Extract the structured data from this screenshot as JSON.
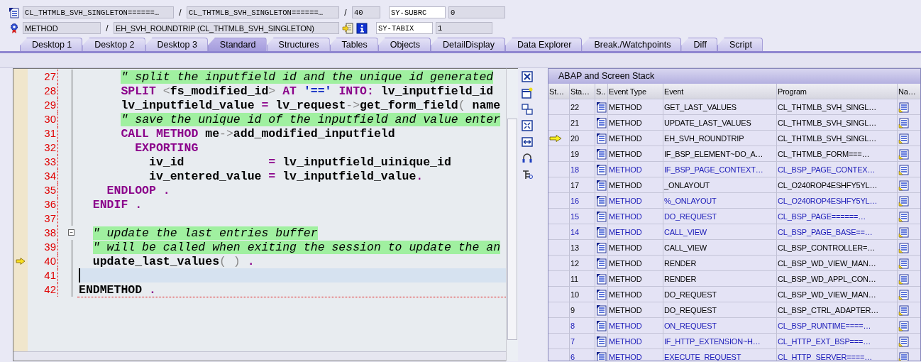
{
  "header_rows": [
    {
      "items": [
        {
          "kind": "field",
          "text": "CL_THTMLB_SVH_SINGLETON======…"
        },
        {
          "kind": "separator",
          "text": "/"
        },
        {
          "kind": "field",
          "text": "CL_THTMLB_SVH_SINGLETON======…"
        },
        {
          "kind": "separator",
          "text": "/"
        },
        {
          "kind": "field",
          "text": "40"
        }
      ],
      "sysvar_name": "SY-SUBRC",
      "sysvar_value": "0"
    },
    {
      "items": [
        {
          "kind": "field",
          "text": "METHOD"
        },
        {
          "kind": "separator",
          "text": "/"
        },
        {
          "kind": "field",
          "text": "EH_SVH_ROUNDTRIP (CL_THTMLB_SVH_SINGLETON)"
        },
        {
          "kind": "navigate"
        },
        {
          "kind": "info"
        }
      ],
      "sysvar_name": "SY-TABIX",
      "sysvar_value": "1"
    }
  ],
  "tabs": [
    {
      "label": "Desktop 1",
      "selected": false
    },
    {
      "label": "Desktop 2",
      "selected": false
    },
    {
      "label": "Desktop 3",
      "selected": false
    },
    {
      "label": "Standard",
      "selected": true
    },
    {
      "label": "Structures",
      "selected": false
    },
    {
      "label": "Tables",
      "selected": false
    },
    {
      "label": "Objects",
      "selected": false
    },
    {
      "label": "DetailDisplay",
      "selected": false
    },
    {
      "label": "Data Explorer",
      "selected": false
    },
    {
      "label": "Break./Watchpoints",
      "selected": false
    },
    {
      "label": "Diff",
      "selected": false
    },
    {
      "label": "Script",
      "selected": false
    }
  ],
  "code_lines": [
    {
      "number": "27",
      "tokens": [
        {
          "kind": "comment",
          "text": "      \" split the inputfield id and the unique id generated"
        }
      ],
      "current": false,
      "cursor": false
    },
    {
      "number": "28",
      "tokens": [
        {
          "kind": "keyword",
          "text": "      SPLIT "
        },
        {
          "kind": "op",
          "text": "<"
        },
        {
          "kind": "ident",
          "text": "fs_modified_id"
        },
        {
          "kind": "op",
          "text": "> "
        },
        {
          "kind": "keyword",
          "text": "AT "
        },
        {
          "kind": "string",
          "text": "'==' "
        },
        {
          "kind": "keyword",
          "text": "INTO: "
        },
        {
          "kind": "ident",
          "text": "lv_inputfield_id"
        }
      ],
      "current": false,
      "cursor": false
    },
    {
      "number": "29",
      "tokens": [
        {
          "kind": "ident",
          "text": "      lv_inputfield_value "
        },
        {
          "kind": "keyword",
          "text": "= "
        },
        {
          "kind": "ident",
          "text": "lv_request"
        },
        {
          "kind": "op",
          "text": "->"
        },
        {
          "kind": "ident",
          "text": "get_form_field"
        },
        {
          "kind": "op",
          "text": "( "
        },
        {
          "kind": "ident",
          "text": "name"
        }
      ],
      "current": false,
      "cursor": false
    },
    {
      "number": "30",
      "tokens": [
        {
          "kind": "comment",
          "text": "      \" save the unique id of the inputfield and value enter"
        }
      ],
      "current": false,
      "cursor": false
    },
    {
      "number": "31",
      "tokens": [
        {
          "kind": "keyword",
          "text": "      CALL METHOD "
        },
        {
          "kind": "ident",
          "text": "me"
        },
        {
          "kind": "op",
          "text": "->"
        },
        {
          "kind": "ident",
          "text": "add_modified_inputfield"
        }
      ],
      "current": false,
      "cursor": false
    },
    {
      "number": "32",
      "tokens": [
        {
          "kind": "keyword",
          "text": "        EXPORTING"
        }
      ],
      "current": false,
      "cursor": false
    },
    {
      "number": "33",
      "tokens": [
        {
          "kind": "ident",
          "text": "          iv_id            "
        },
        {
          "kind": "keyword",
          "text": "= "
        },
        {
          "kind": "ident",
          "text": "lv_inputfield_uinique_id"
        }
      ],
      "current": false,
      "cursor": false
    },
    {
      "number": "34",
      "tokens": [
        {
          "kind": "ident",
          "text": "          iv_entered_value "
        },
        {
          "kind": "keyword",
          "text": "= "
        },
        {
          "kind": "ident",
          "text": "lv_inputfield_value"
        },
        {
          "kind": "keyword",
          "text": "."
        }
      ],
      "current": false,
      "cursor": false
    },
    {
      "number": "35",
      "tokens": [
        {
          "kind": "keyword",
          "text": "    ENDLOOP ."
        }
      ],
      "current": false,
      "cursor": false
    },
    {
      "number": "36",
      "tokens": [
        {
          "kind": "keyword",
          "text": "  ENDIF ."
        }
      ],
      "current": false,
      "cursor": false
    },
    {
      "number": "37",
      "current": false,
      "cursor": false
    },
    {
      "number": "38",
      "fold_box": true,
      "tokens": [
        {
          "kind": "comment",
          "text": "  \" update the last entries buffer"
        }
      ],
      "current": false,
      "cursor": false
    },
    {
      "number": "39",
      "tokens": [
        {
          "kind": "comment",
          "text": "  \" will be called when exiting the session to update the an"
        }
      ],
      "current": false,
      "cursor": false
    },
    {
      "number": "40",
      "tokens": [
        {
          "kind": "ident",
          "text": "  update_last_values"
        },
        {
          "kind": "op",
          "text": "( ) "
        },
        {
          "kind": "keyword",
          "text": "."
        }
      ],
      "current": true,
      "cursor": false
    },
    {
      "number": "41",
      "current": false,
      "cursor": true
    },
    {
      "number": "42",
      "tokens": [
        {
          "kind": "ident",
          "text": "ENDMETHOD"
        },
        {
          "kind": "keyword",
          "text": " ."
        }
      ],
      "current": false,
      "cursor": false
    }
  ],
  "stack": {
    "title": "ABAP and Screen Stack",
    "columns": [
      "St…",
      "Sta…",
      "S..",
      "Event Type",
      "Event",
      "Program",
      "Na…"
    ],
    "rows": [
      {
        "level": "22",
        "event_type": "METHOD",
        "event": "GET_LAST_VALUES",
        "program": "CL_THTMLB_SVH_SINGL…",
        "current": false,
        "highlighted": false
      },
      {
        "level": "21",
        "event_type": "METHOD",
        "event": "UPDATE_LAST_VALUES",
        "program": "CL_THTMLB_SVH_SINGL…",
        "current": false,
        "highlighted": false
      },
      {
        "level": "20",
        "event_type": "METHOD",
        "event": "EH_SVH_ROUNDTRIP",
        "program": "CL_THTMLB_SVH_SINGL…",
        "current": true,
        "highlighted": false
      },
      {
        "level": "19",
        "event_type": "METHOD",
        "event": "IF_BSP_ELEMENT~DO_A…",
        "program": "CL_THTMLB_FORM===…",
        "current": false,
        "highlighted": false
      },
      {
        "level": "18",
        "event_type": "METHOD",
        "event": "IF_BSP_PAGE_CONTEXT…",
        "program": "CL_BSP_PAGE_CONTEX…",
        "current": false,
        "highlighted": true
      },
      {
        "level": "17",
        "event_type": "METHOD",
        "event": "_ONLAYOUT",
        "program": "CL_O240ROP4ESHFY5YL…",
        "current": false,
        "highlighted": false
      },
      {
        "level": "16",
        "event_type": "METHOD",
        "event": "%_ONLAYOUT",
        "program": "CL_O240ROP4ESHFY5YL…",
        "current": false,
        "highlighted": true
      },
      {
        "level": "15",
        "event_type": "METHOD",
        "event": "DO_REQUEST",
        "program": "CL_BSP_PAGE======…",
        "current": false,
        "highlighted": true
      },
      {
        "level": "14",
        "event_type": "METHOD",
        "event": "CALL_VIEW",
        "program": "CL_BSP_PAGE_BASE==…",
        "current": false,
        "highlighted": true
      },
      {
        "level": "13",
        "event_type": "METHOD",
        "event": "CALL_VIEW",
        "program": "CL_BSP_CONTROLLER=…",
        "current": false,
        "highlighted": false
      },
      {
        "level": "12",
        "event_type": "METHOD",
        "event": "RENDER",
        "program": "CL_BSP_WD_VIEW_MAN…",
        "current": false,
        "highlighted": false
      },
      {
        "level": "11",
        "event_type": "METHOD",
        "event": "RENDER",
        "program": "CL_BSP_WD_APPL_CON…",
        "current": false,
        "highlighted": false
      },
      {
        "level": "10",
        "event_type": "METHOD",
        "event": "DO_REQUEST",
        "program": "CL_BSP_WD_VIEW_MAN…",
        "current": false,
        "highlighted": false
      },
      {
        "level": "9",
        "event_type": "METHOD",
        "event": "DO_REQUEST",
        "program": "CL_BSP_CTRL_ADAPTER…",
        "current": false,
        "highlighted": false
      },
      {
        "level": "8",
        "event_type": "METHOD",
        "event": "ON_REQUEST",
        "program": "CL_BSP_RUNTIME====…",
        "current": false,
        "highlighted": true
      },
      {
        "level": "7",
        "event_type": "METHOD",
        "event": "IF_HTTP_EXTENSION~H…",
        "program": "CL_HTTP_EXT_BSP===…",
        "current": false,
        "highlighted": true
      },
      {
        "level": "6",
        "event_type": "METHOD",
        "event": "EXECUTE_REQUEST",
        "program": "CL_HTTP_SERVER====…",
        "current": false,
        "highlighted": true
      }
    ]
  }
}
